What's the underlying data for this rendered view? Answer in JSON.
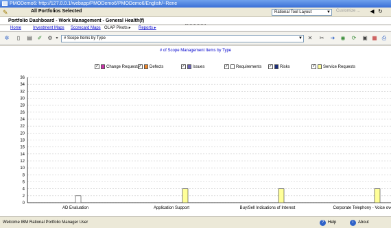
{
  "window": {
    "title": "PMODemo6: http://127.0.0.1/webapp/PMODemo6/PMODemo6/English/~Rene"
  },
  "topbar": {
    "portfolio_label": "All Portfolios Selected",
    "layout_select": "Rational Tool Layout",
    "customize_label": "Customize ..."
  },
  "dashboard": {
    "title": "Portfolio Dashboard - Work Management - General Health(f)"
  },
  "links": {
    "home": "Home",
    "investment_maps": "Investment Maps",
    "scorecard_maps": "Scorecard Maps",
    "olap_pivots": "OLAP Pivots",
    "reports": "Reports"
  },
  "toolbar": {
    "view_select": "# Scope Items by Type"
  },
  "chart_data": {
    "type": "bar",
    "title": "# of Scope Management Items by Type",
    "categories": [
      "AD Evaluation",
      "Application Support",
      "Buy/Sell Indications of Interest",
      "Corporate Telephony - Voice over"
    ],
    "ylim": [
      0,
      36
    ],
    "yticks": [
      "0",
      "2",
      "4",
      "6",
      "8",
      "10",
      "12",
      "14",
      "16",
      "18",
      "20",
      "22",
      "24",
      "26",
      "28",
      "30",
      "32",
      "34",
      "36"
    ],
    "grid": true,
    "legend_position": "top",
    "series": [
      {
        "name": "Change Requests",
        "color": "#cc33aa",
        "checked": true,
        "values": [
          0,
          0,
          0,
          0
        ]
      },
      {
        "name": "Defects",
        "color": "#f08a30",
        "checked": true,
        "values": [
          0,
          0,
          0,
          0
        ]
      },
      {
        "name": "Issues",
        "color": "#6b64b8",
        "checked": true,
        "values": [
          0,
          0,
          0,
          0
        ]
      },
      {
        "name": "Requirements",
        "color": "#ffffff",
        "checked": true,
        "values": [
          2,
          0,
          0,
          0
        ]
      },
      {
        "name": "Risks",
        "color": "#1c2e7a",
        "checked": true,
        "values": [
          0,
          0,
          0,
          0
        ]
      },
      {
        "name": "Service Requests",
        "color": "#ffff99",
        "checked": true,
        "values": [
          0,
          4,
          4,
          4
        ]
      }
    ]
  },
  "status": {
    "welcome": "Welcome IBM Rational Portfolio Manager User",
    "help": "Help",
    "about": "About"
  }
}
